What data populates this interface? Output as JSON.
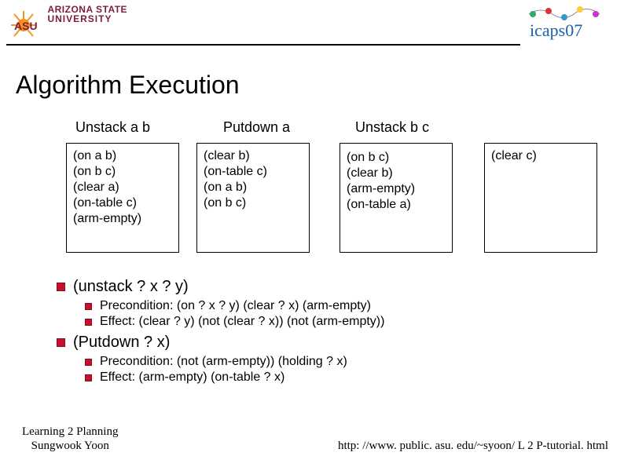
{
  "header": {
    "asu_line1": "ARIZONA STATE",
    "asu_line2": "UNIVERSITY",
    "icaps_text": "icaps07"
  },
  "title": "Algorithm Execution",
  "steps": {
    "s1": "Unstack a b",
    "s2": "Putdown a",
    "s3": "Unstack b c"
  },
  "states": {
    "box1": {
      "l1": "(on a b)",
      "l2": "(on b c)",
      "l3": "(clear a)",
      "l4": "(on-table c)",
      "l5": "(arm-empty)"
    },
    "box2": {
      "l1": "(clear b)",
      "l2": "(on-table c)",
      "l3": "(on a b)",
      "l4": "(on b c)"
    },
    "box3": {
      "l1": "(on b c)",
      "l2": "(clear b)",
      "l3": "(arm-empty)",
      "l4": "(on-table a)"
    },
    "box4": {
      "l1": "(clear c)"
    }
  },
  "defs": {
    "unstack_head": "(unstack ? x ? y)",
    "unstack_pre": "Precondition: (on ? x ? y) (clear ? x)  (arm-empty)",
    "unstack_eff": "Effect: (clear ? y) (not (clear ? x)) (not (arm-empty))",
    "putdown_head": "(Putdown ? x)",
    "putdown_pre": "Precondition: (not (arm-empty)) (holding ? x)",
    "putdown_eff": "Effect: (arm-empty) (on-table ? x)"
  },
  "footer": {
    "left_line1": "Learning 2 Planning",
    "left_line2": "Sungwook Yoon",
    "right": "http: //www. public. asu. edu/~syoon/ L 2 P-tutorial. html"
  }
}
